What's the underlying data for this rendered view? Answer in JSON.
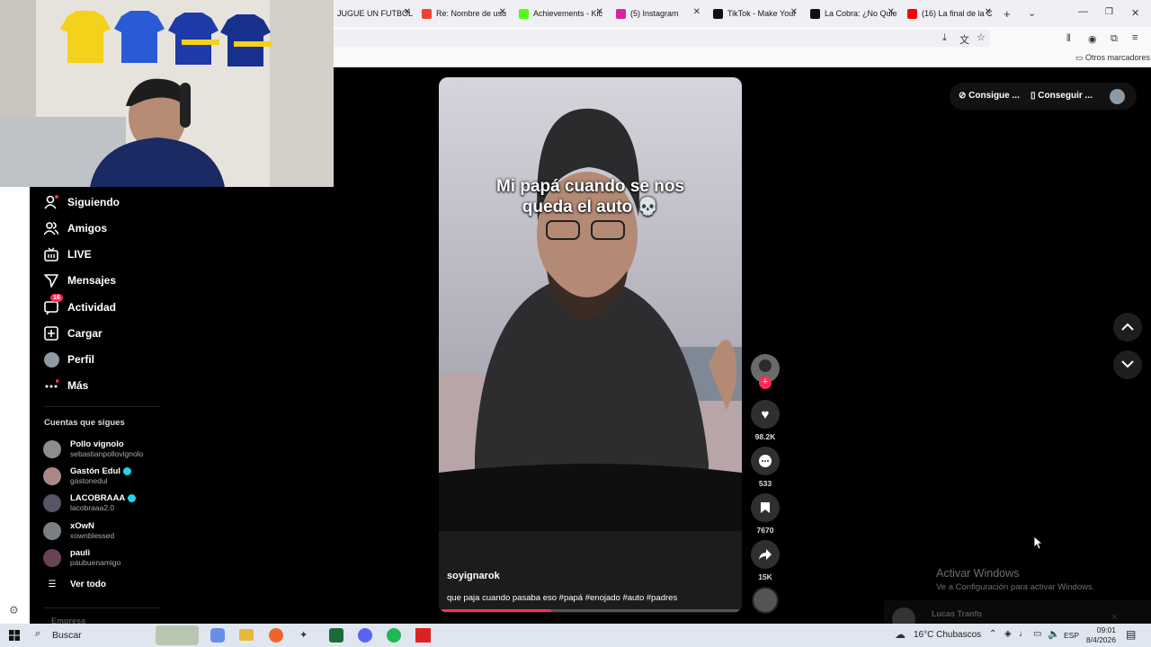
{
  "browser": {
    "tabs": [
      {
        "label": "JUGUE UN FUTBOL",
        "favicon_color": "#6b6b6b"
      },
      {
        "label": "Re: Nombre de usu",
        "favicon_color": "#ea4335"
      },
      {
        "label": "Achievements - Kic",
        "favicon_color": "#53fc18"
      },
      {
        "label": "(5) Instagram",
        "favicon_color": "#d6249f"
      },
      {
        "label": "TikTok - Make Your",
        "favicon_color": "#111111"
      },
      {
        "label": "La Cobra: ¿No Quie",
        "favicon_color": "#111111"
      },
      {
        "label": "(16) La final de la C",
        "favicon_color": "#ff0000"
      }
    ],
    "bookmarks_label": "Otros marcadores"
  },
  "sidebar": {
    "nav": [
      {
        "label": "Siguiendo",
        "icon": "following-icon"
      },
      {
        "label": "Amigos",
        "icon": "friends-icon"
      },
      {
        "label": "LIVE",
        "icon": "live-icon"
      },
      {
        "label": "Mensajes",
        "icon": "messages-icon"
      },
      {
        "label": "Actividad",
        "icon": "activity-icon",
        "badge": "16"
      },
      {
        "label": "Cargar",
        "icon": "upload-icon"
      },
      {
        "label": "Perfil",
        "icon": "profile-avatar"
      },
      {
        "label": "Más",
        "icon": "more-icon"
      }
    ],
    "following_title": "Cuentas que sigues",
    "accounts": [
      {
        "name": "Pollo vignolo",
        "handle": "sebastianpollovignolo",
        "verified": false
      },
      {
        "name": "Gastón Edul",
        "handle": "gastonedul",
        "verified": true
      },
      {
        "name": "LACOBRAAA",
        "handle": "lacobraaa2.0",
        "verified": true
      },
      {
        "name": "xOwN",
        "handle": "xownblessed",
        "verified": false
      },
      {
        "name": "pauli",
        "handle": "paubuenamigo",
        "verified": false
      }
    ],
    "see_all": "Ver todo",
    "company": "Empresa"
  },
  "topbar": {
    "get_coins": "Consigue ...",
    "get_app": "Conseguir ..."
  },
  "video": {
    "overlay_text": "Mi papá cuando se nos queda el auto 💀",
    "author": "soyignarok",
    "caption": "que paja cuando pasaba eso #papá #enojado #auto #padres",
    "progress": 0.37
  },
  "actions": {
    "likes": "98.2K",
    "comments": "533",
    "saves": "7670",
    "shares": "15K"
  },
  "windows_watermark": {
    "title": "Activar Windows",
    "subtitle": "Ve a Configuración para activar Windows."
  },
  "chat_popup_name": "Lucas Tranfo",
  "taskbar": {
    "search": "Buscar",
    "weather": "16°C  Chubascos",
    "lang": "ESP",
    "time": "09:01",
    "date": "8/4/2026"
  }
}
